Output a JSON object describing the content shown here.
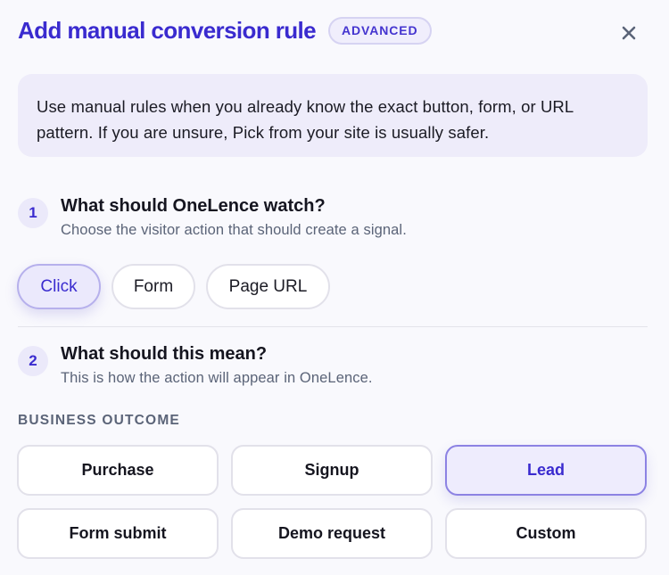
{
  "modal": {
    "title": "Add manual conversion rule",
    "badge": "ADVANCED",
    "close_icon": "close-icon"
  },
  "info": {
    "text": "Use manual rules when you already know the exact button, form, or URL pattern. If you are unsure, Pick from your site is usually safer."
  },
  "step1": {
    "number": "1",
    "title": "What should OneLence watch?",
    "subtitle": "Choose the visitor action that should create a signal.",
    "options": [
      "Click",
      "Form",
      "Page URL"
    ],
    "selected": "Click"
  },
  "step2": {
    "number": "2",
    "title": "What should this mean?",
    "subtitle": "This is how the action will appear in OneLence."
  },
  "business_outcome": {
    "label": "BUSINESS OUTCOME",
    "options": [
      "Purchase",
      "Signup",
      "Lead",
      "Form submit",
      "Demo request",
      "Custom"
    ],
    "selected": "Lead"
  },
  "colors": {
    "accent": "#3a2bcf",
    "background": "#f9f9fd",
    "info_bg": "#eeecfa",
    "muted_text": "#5b6478"
  }
}
